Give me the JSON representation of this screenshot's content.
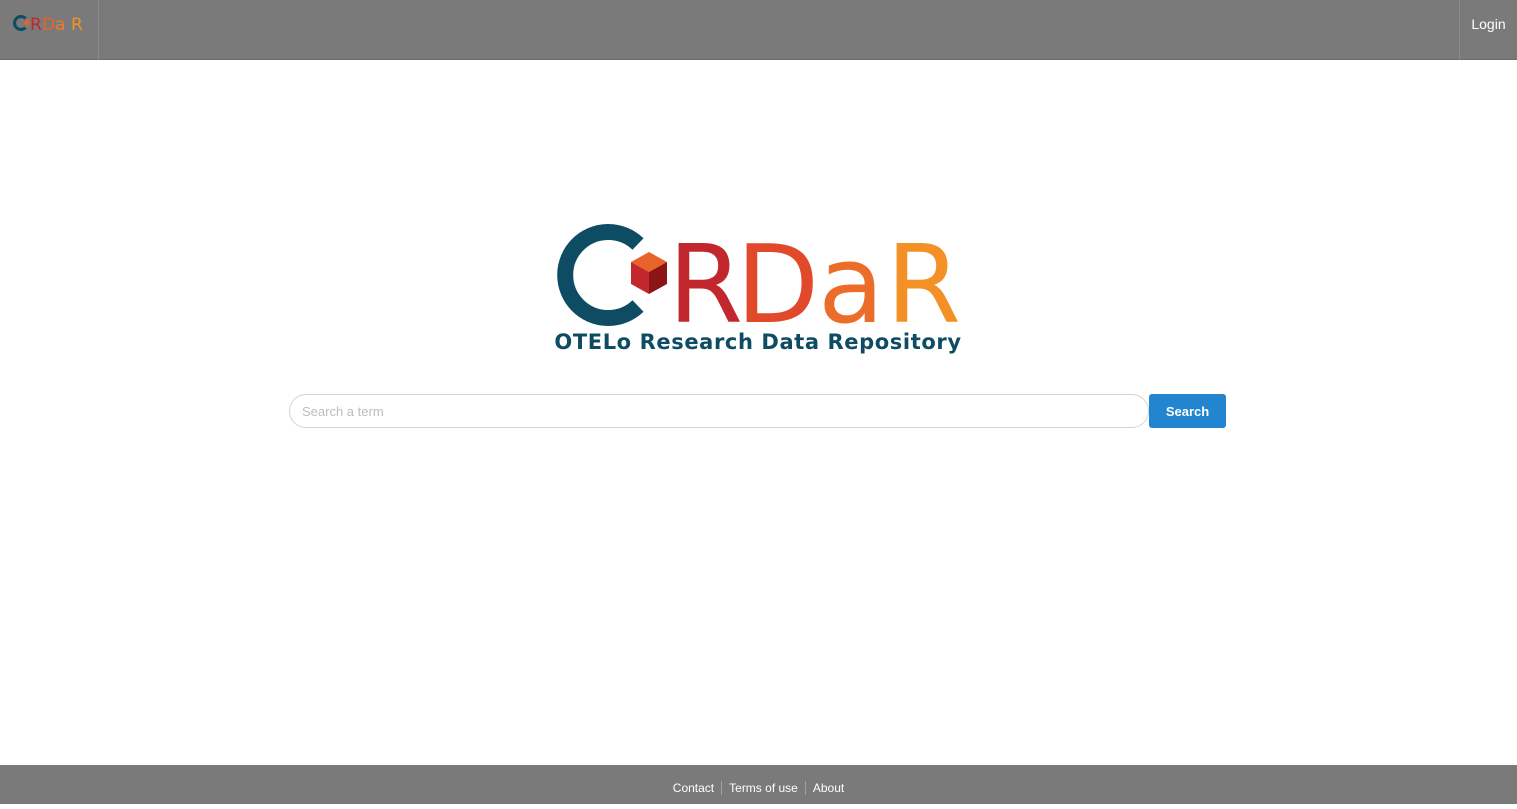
{
  "navbar": {
    "brand_logo": "ORDaR",
    "login_label": "Login"
  },
  "hero": {
    "logo_text": "ORDaR",
    "subtitle": "OTELo Research Data Repository"
  },
  "search": {
    "placeholder": "Search a term",
    "value": "",
    "button_label": "Search"
  },
  "footer": {
    "links": [
      "Contact",
      "Terms of use",
      "About"
    ]
  },
  "colors": {
    "navbar_bg": "#7a7a7a",
    "navy": "#0d4c63",
    "red": "#c1272d",
    "orange": "#e8632a",
    "light_orange": "#f39127",
    "button_blue": "#2185d0"
  }
}
